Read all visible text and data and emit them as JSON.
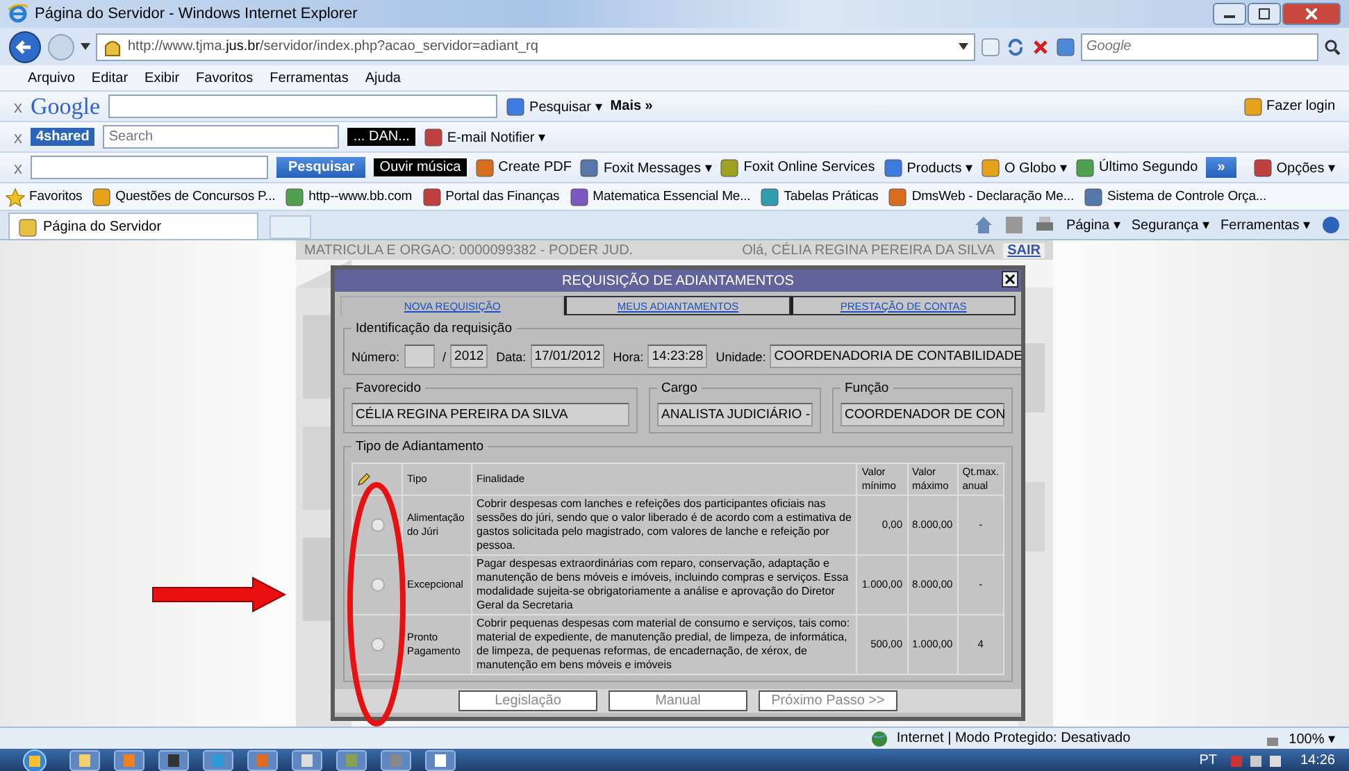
{
  "window": {
    "title": "Página do Servidor - Windows Internet Explorer"
  },
  "address_bar": {
    "url": "http://www.tjma.**jus.br**/servidor/index.php?acao_servidor=adiant_rq",
    "search_placeholder": "Google"
  },
  "menu": [
    "Arquivo",
    "Editar",
    "Exibir",
    "Favoritos",
    "Ferramentas",
    "Ajuda"
  ],
  "toolbars": [
    {
      "left": [
        {
          "kind": "close",
          "text": "x"
        },
        {
          "kind": "logo",
          "text": "Google"
        },
        {
          "kind": "field"
        },
        {
          "kind": "link",
          "text": "Pesquisar ▾"
        },
        {
          "kind": "menu",
          "text": "Mais »"
        }
      ],
      "right": [
        {
          "kind": "link",
          "text": "Fazer login"
        }
      ]
    },
    {
      "left": [
        {
          "kind": "close",
          "text": "x"
        },
        {
          "kind": "badge-logo",
          "text": "4shared"
        },
        {
          "kind": "field",
          "placeholder": "Search"
        },
        {
          "kind": "display",
          "text": "... DAN..."
        },
        {
          "kind": "link",
          "text": "E-mail Notifier ▾"
        }
      ]
    },
    {
      "left": [
        {
          "kind": "close",
          "text": "x"
        },
        {
          "kind": "field"
        },
        {
          "kind": "button",
          "text": "Pesquisar"
        },
        {
          "kind": "display",
          "text": "Ouvir música"
        },
        {
          "kind": "link",
          "text": "Create PDF"
        },
        {
          "kind": "link",
          "text": "Foxit Messages ▾"
        },
        {
          "kind": "link",
          "text": "Foxit Online Services"
        },
        {
          "kind": "link",
          "text": "Products ▾"
        },
        {
          "kind": "link",
          "text": "O Globo ▾"
        },
        {
          "kind": "link",
          "text": "Último Segundo"
        },
        {
          "kind": "button",
          "text": "»"
        }
      ],
      "right": [
        {
          "kind": "link",
          "text": "Opções ▾"
        }
      ]
    }
  ],
  "favorites": [
    "Favoritos",
    "Questões de Concursos P...",
    "http--www.bb.com",
    "Portal das Finanças",
    "Matematica Essencial Me...",
    "Tabelas Práticas",
    "DmsWeb - Declaração Me...",
    "Sistema de Controle Orça..."
  ],
  "tabs": [
    {
      "label": "Página do Servidor",
      "selected": true
    }
  ],
  "commands": [
    "Página ▾",
    "Segurança ▾",
    "Ferramentas ▾"
  ],
  "page": {
    "header": "MATRICULA E ORGAO: 0000099382 - PODER JUD.",
    "greeting": "Olá, CÉLIA REGINA PEREIRA DA SILVA",
    "logout": "SAIR"
  },
  "dialog": {
    "title": "REQUISIÇÃO DE ADIANTAMENTOS",
    "tabs": [
      {
        "label": "NOVA REQUISIÇÃO",
        "selected": true
      },
      {
        "label": "MEUS ADIANTAMENTOS",
        "selected": false
      },
      {
        "label": "PRESTAÇÃO DE CONTAS",
        "selected": false
      }
    ],
    "identification": {
      "legend": "Identificação da requisição",
      "fields": [
        {
          "label": "Número:"
        },
        {
          "label": "/",
          "value": "2012"
        },
        {
          "label": "Data:",
          "value": "17/01/2012"
        },
        {
          "label": "Hora:",
          "value": "14:23:28"
        },
        {
          "label": "Unidade:",
          "value": "COORDENADORIA DE CONTABILIDADE"
        }
      ]
    },
    "people": [
      {
        "legend": "Favorecido",
        "value": "CÉLIA REGINA PEREIRA DA SILVA"
      },
      {
        "legend": "Cargo",
        "value": "ANALISTA JUDICIÁRIO -"
      },
      {
        "legend": "Função",
        "value": "COORDENADOR DE CON"
      }
    ],
    "advance_type": {
      "legend": "Tipo de Adiantamento",
      "columns": [
        "Tipo",
        "Finalidade",
        "Valor mínimo",
        "Valor máximo",
        "Qt.max. anual"
      ],
      "rows": [
        {
          "selected": false,
          "tipo": "Alimentação do Júri",
          "finalidade": "Cobrir despesas com lanches e refeições dos participantes oficiais nas sessões do júri, sendo que o valor liberado é de acordo com a estimativa de gastos solicitada pelo magistrado, com valores de lanche e refeição por pessoa.",
          "min": "0,00",
          "max": "8.000,00",
          "qt": "-"
        },
        {
          "selected": false,
          "tipo": "Excepcional",
          "finalidade": "Pagar despesas extraordinárias com reparo, conservação, adaptação e manutenção de bens móveis e imóveis, incluindo compras e serviços. Essa modalidade sujeita-se obrigatoriamente a análise e aprovação do Diretor Geral da Secretaria",
          "min": "1.000,00",
          "max": "8.000,00",
          "qt": "-"
        },
        {
          "selected": false,
          "tipo": "Pronto Pagamento",
          "finalidade": "Cobrir pequenas despesas com material de consumo e serviços, tais como: material de expediente, de manutenção predial, de limpeza, de informática, de limpeza, de pequenas reformas, de encadernação, de xérox, de manutenção em bens móveis e imóveis",
          "min": "500,00",
          "max": "1.000,00",
          "qt": "4"
        }
      ]
    },
    "buttons": [
      "Legislação",
      "Manual",
      "Próximo Passo >>"
    ]
  },
  "status_bar": {
    "zone": "Internet | Modo Protegido: Desativado",
    "zoom": "100% ▾"
  },
  "taskbar": {
    "language": "PT",
    "clock": "14:26"
  }
}
